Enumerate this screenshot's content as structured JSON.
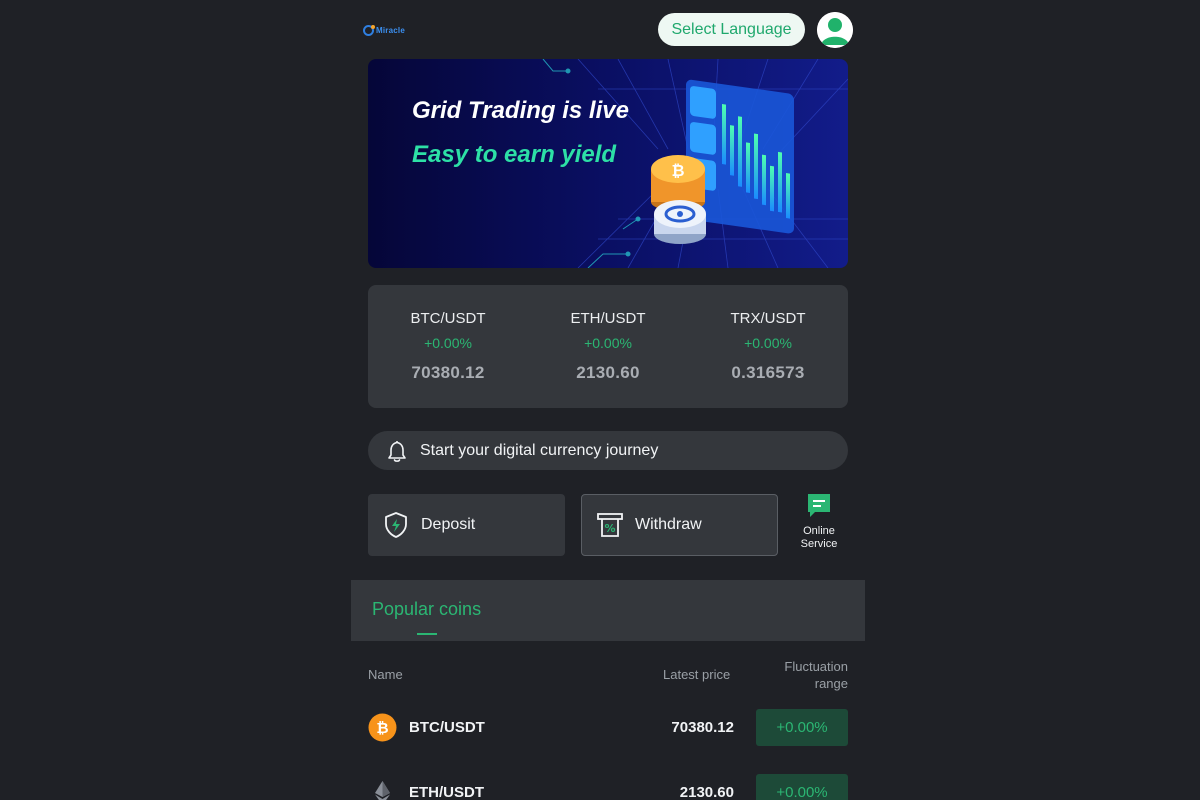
{
  "header": {
    "logo_text": "Miracle",
    "language_button": "Select Language",
    "avatar_icon": "user-avatar-icon"
  },
  "banner": {
    "title": "Grid Trading is live",
    "subtitle": "Easy to earn yield"
  },
  "ticker": [
    {
      "pair": "BTC/USDT",
      "change": "+0.00%",
      "price": "70380.12"
    },
    {
      "pair": "ETH/USDT",
      "change": "+0.00%",
      "price": "2130.60"
    },
    {
      "pair": "TRX/USDT",
      "change": "+0.00%",
      "price": "0.316573"
    }
  ],
  "notice": {
    "icon": "bell-icon",
    "text": "Start your digital currency journey"
  },
  "actions": {
    "deposit": {
      "label": "Deposit",
      "icon": "shield-lightning-icon"
    },
    "withdraw": {
      "label": "Withdraw",
      "icon": "receipt-percent-icon"
    },
    "online_service": {
      "label_line1": "Online",
      "label_line2": "Service",
      "icon": "chat-icon"
    }
  },
  "popular": {
    "tab_label": "Popular coins",
    "columns": {
      "name": "Name",
      "latest_price": "Latest price",
      "range_line1": "Fluctuation",
      "range_line2": "range"
    },
    "rows": [
      {
        "pair": "BTC/USDT",
        "price": "70380.12",
        "change": "+0.00%",
        "icon": "bitcoin-icon"
      },
      {
        "pair": "ETH/USDT",
        "price": "2130.60",
        "change": "+0.00%",
        "icon": "ethereum-icon"
      }
    ]
  },
  "colors": {
    "background": "#1f2126",
    "card": "#34373c",
    "accent_green": "#2bb673",
    "change_bg": "#1d4a38"
  }
}
